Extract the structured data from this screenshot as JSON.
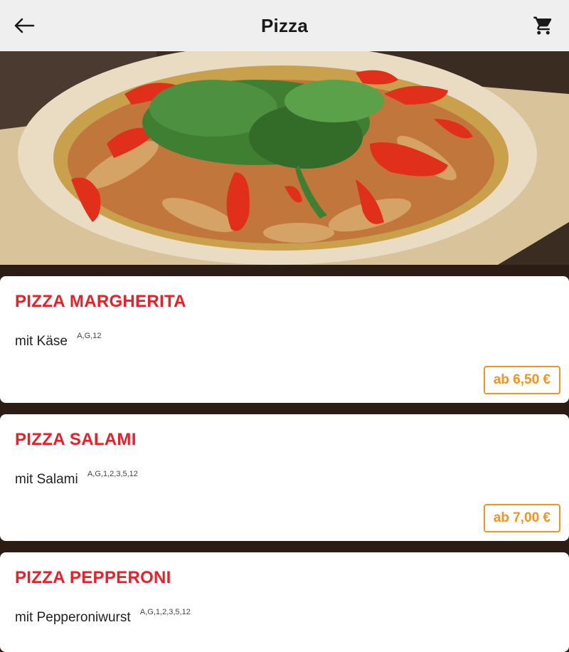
{
  "header": {
    "title": "Pizza",
    "back_icon": "arrow-left-icon",
    "cart_icon": "cart-icon"
  },
  "hero": {
    "image": "pizza-photo"
  },
  "menu": {
    "items": [
      {
        "name": "PIZZA MARGHERITA",
        "desc": "mit Käse",
        "allergens": "A,G,12",
        "price": "ab 6,50 €"
      },
      {
        "name": "PIZZA SALAMI",
        "desc": "mit Salami",
        "allergens": "A,G,1,2,3,5,12",
        "price": "ab 7,00 €"
      },
      {
        "name": "PIZZA PEPPERONI",
        "desc": "mit Pepperoniwurst",
        "allergens": "A,G,1,2,3,5,12"
      }
    ]
  },
  "colors": {
    "accent_red": "#e8202a",
    "accent_orange": "#f39322",
    "header_bg": "#efefef",
    "list_bg": "#2b1d14"
  }
}
